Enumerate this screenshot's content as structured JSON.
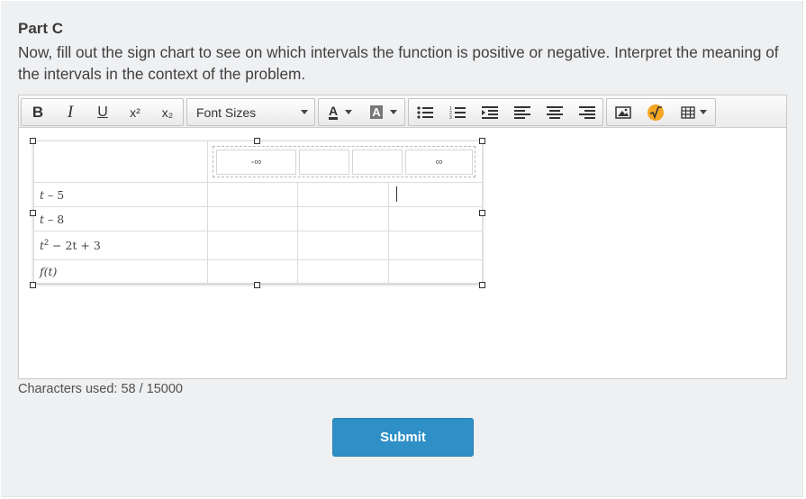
{
  "part_title": "Part C",
  "instructions": "Now, fill out the sign chart to see on which intervals the function is positive or negative. Interpret the meaning of the intervals in the context of the problem.",
  "toolbar": {
    "bold": "B",
    "italic": "I",
    "underline": "U",
    "superscript": "x²",
    "subscript": "x₂",
    "font_sizes_label": "Font Sizes",
    "font_color": "A",
    "highlight_color": "A",
    "icons": [
      "bold-icon",
      "italic-icon",
      "underline-icon",
      "superscript-icon",
      "subscript-icon",
      "font-color-icon",
      "highlight-icon",
      "bulleted-list-icon",
      "numbered-list-icon",
      "indent-icon",
      "align-left-icon",
      "align-center-icon",
      "align-right-icon",
      "image-icon",
      "math-icon",
      "table-icon"
    ]
  },
  "sign_chart": {
    "header": [
      "-∞",
      "∞"
    ],
    "rows": [
      {
        "label_main": "t",
        "label_rest": " – 5"
      },
      {
        "label_main": "t",
        "label_rest": " – 8"
      },
      {
        "label_main": "t",
        "label_sup": "2",
        "label_rest": " − 2t + 3"
      },
      {
        "label_main": "f(t)"
      }
    ]
  },
  "characters_used": "Characters used: 58 / 15000",
  "submit_label": "Submit",
  "colors": {
    "panel_bg": "#eff0f2",
    "submit_bg": "#2f8fc7",
    "math_icon_bg": "#f5a623"
  }
}
